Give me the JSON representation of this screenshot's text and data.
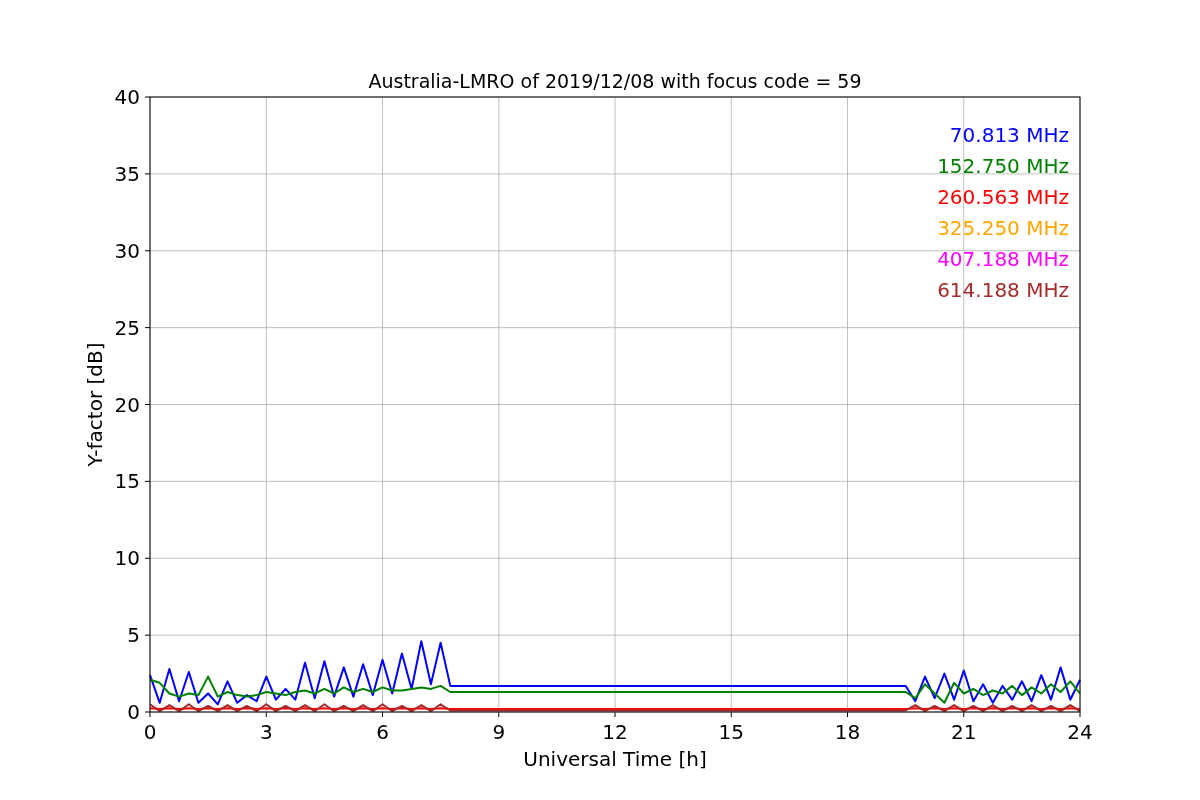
{
  "figure": {
    "chart_data": {
      "type": "line",
      "title": "Australia-LMRO of 2019/12/08 with focus code = 59",
      "xlabel": "Universal Time [h]",
      "ylabel": "Y-factor [dB]",
      "x": [
        0,
        0.25,
        0.5,
        0.75,
        1,
        1.25,
        1.5,
        1.75,
        2,
        2.25,
        2.5,
        2.75,
        3,
        3.25,
        3.5,
        3.75,
        4,
        4.25,
        4.5,
        4.75,
        5,
        5.25,
        5.5,
        5.75,
        6,
        6.25,
        6.5,
        6.75,
        7,
        7.25,
        7.5,
        7.75,
        19.5,
        19.75,
        20,
        20.25,
        20.5,
        20.75,
        21,
        21.25,
        21.5,
        21.75,
        22,
        22.25,
        22.5,
        22.75,
        23,
        23.25,
        23.5,
        23.75,
        24
      ],
      "series": [
        {
          "name": "70.813 MHz",
          "color": "#0000ff",
          "values": [
            2.4,
            0.6,
            2.8,
            0.7,
            2.6,
            0.6,
            1.2,
            0.5,
            2.0,
            0.6,
            1.1,
            0.7,
            2.3,
            0.8,
            1.5,
            0.8,
            3.2,
            0.9,
            3.3,
            1.0,
            2.9,
            1.0,
            3.1,
            1.1,
            3.4,
            1.2,
            3.8,
            1.5,
            4.6,
            1.8,
            4.5,
            1.7,
            1.7,
            0.7,
            2.3,
            0.9,
            2.5,
            0.8,
            2.7,
            0.7,
            1.8,
            0.6,
            1.7,
            0.8,
            2.0,
            0.7,
            2.4,
            0.8,
            2.9,
            0.8,
            2.1
          ]
        },
        {
          "name": "152.750 MHz",
          "color": "#008000",
          "values": [
            2.1,
            1.9,
            1.2,
            1.0,
            1.2,
            1.1,
            2.3,
            1.0,
            1.3,
            1.1,
            1.0,
            1.1,
            1.3,
            1.2,
            1.1,
            1.3,
            1.4,
            1.2,
            1.5,
            1.2,
            1.6,
            1.3,
            1.5,
            1.3,
            1.6,
            1.4,
            1.4,
            1.5,
            1.6,
            1.5,
            1.7,
            1.3,
            1.3,
            0.9,
            1.8,
            1.2,
            0.6,
            1.9,
            1.2,
            1.5,
            1.1,
            1.4,
            1.2,
            1.7,
            1.1,
            1.6,
            1.2,
            1.8,
            1.3,
            2.0,
            1.2
          ]
        },
        {
          "name": "260.563 MHz",
          "color": "#ff0000",
          "values": [
            0.25,
            0.2,
            0.25,
            0.2,
            0.25,
            0.2,
            0.25,
            0.2,
            0.25,
            0.2,
            0.25,
            0.2,
            0.25,
            0.2,
            0.25,
            0.2,
            0.25,
            0.2,
            0.25,
            0.2,
            0.25,
            0.2,
            0.25,
            0.2,
            0.25,
            0.2,
            0.25,
            0.2,
            0.25,
            0.2,
            0.25,
            0.2,
            0.2,
            0.25,
            0.2,
            0.25,
            0.2,
            0.25,
            0.2,
            0.25,
            0.2,
            0.25,
            0.2,
            0.25,
            0.2,
            0.25,
            0.2,
            0.25,
            0.2,
            0.25,
            0.2
          ]
        },
        {
          "name": "325.250 MHz",
          "color": "#ffa500",
          "values": [
            null,
            null,
            null,
            null,
            null,
            null,
            null,
            null,
            null,
            null,
            null,
            null,
            null,
            null,
            null,
            null,
            null,
            null,
            null,
            null,
            null,
            null,
            null,
            null,
            null,
            null,
            null,
            null,
            null,
            null,
            null,
            null,
            null,
            null,
            null,
            null,
            null,
            null,
            null,
            null,
            null,
            null,
            null,
            null,
            null,
            null,
            null,
            null,
            null,
            null,
            null
          ]
        },
        {
          "name": "407.188 MHz",
          "color": "#ff00ff",
          "values": [
            null,
            null,
            null,
            null,
            null,
            null,
            null,
            null,
            null,
            null,
            null,
            null,
            null,
            null,
            null,
            null,
            null,
            null,
            null,
            null,
            null,
            null,
            null,
            null,
            null,
            null,
            null,
            null,
            null,
            null,
            null,
            null,
            null,
            null,
            null,
            null,
            null,
            null,
            null,
            null,
            null,
            null,
            null,
            null,
            null,
            null,
            null,
            null,
            null,
            null,
            null
          ]
        },
        {
          "name": "614.188 MHz",
          "color": "#a52a2a",
          "values": [
            0.5,
            0.05,
            0.45,
            0.05,
            0.5,
            0.05,
            0.4,
            0.05,
            0.45,
            0.05,
            0.4,
            0.05,
            0.5,
            0.05,
            0.4,
            0.05,
            0.45,
            0.05,
            0.5,
            0.05,
            0.4,
            0.05,
            0.45,
            0.05,
            0.5,
            0.05,
            0.4,
            0.05,
            0.45,
            0.05,
            0.5,
            0.1,
            0.1,
            0.45,
            0.05,
            0.4,
            0.05,
            0.45,
            0.05,
            0.4,
            0.05,
            0.45,
            0.05,
            0.4,
            0.05,
            0.45,
            0.05,
            0.4,
            0.05,
            0.45,
            0.05
          ]
        }
      ],
      "xlim": [
        0,
        24
      ],
      "ylim": [
        0,
        40
      ],
      "xticks": [
        0,
        3,
        6,
        9,
        12,
        15,
        18,
        21,
        24
      ],
      "yticks": [
        0,
        5,
        10,
        15,
        20,
        25,
        30,
        35,
        40
      ],
      "grid": true
    }
  }
}
